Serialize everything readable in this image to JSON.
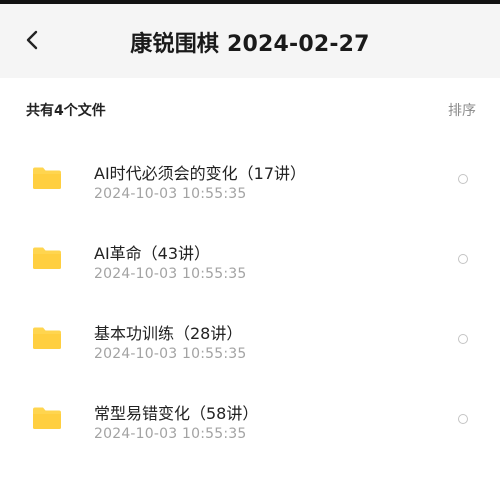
{
  "header": {
    "title": "康锐围棋 2024-02-27",
    "back_icon": "chevron-left-icon"
  },
  "toolbar": {
    "count_label": "共有4个文件",
    "sort_label": "排序"
  },
  "files": [
    {
      "name": "AI时代必须会的变化（17讲）",
      "time": "2024-10-03  10:55:35",
      "icon": "folder-icon"
    },
    {
      "name": "AI革命（43讲）",
      "time": "2024-10-03  10:55:35",
      "icon": "folder-icon"
    },
    {
      "name": "基本功训练（28讲）",
      "time": "2024-10-03  10:55:35",
      "icon": "folder-icon"
    },
    {
      "name": "常型易错变化（58讲）",
      "time": "2024-10-03  10:55:35",
      "icon": "folder-icon"
    }
  ],
  "colors": {
    "folder": "#FFD54F",
    "header_bg": "#F5F5F5",
    "secondary_text": "#A3A3A3"
  }
}
